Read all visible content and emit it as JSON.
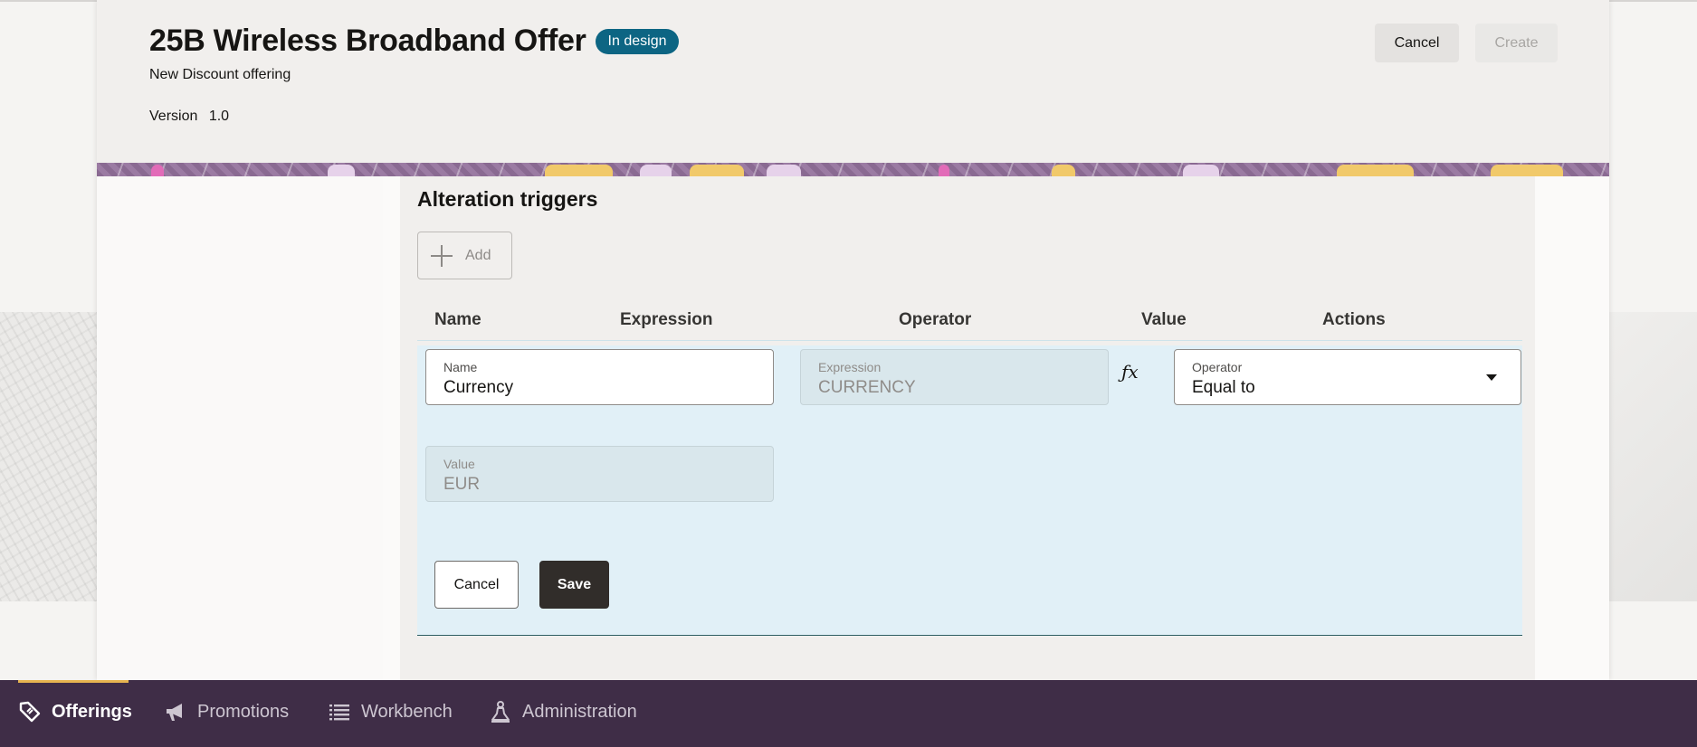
{
  "header": {
    "title": "25B Wireless Broadband Offer",
    "status": "In design",
    "subtitle": "New Discount offering",
    "version_label": "Version",
    "version_value": "1.0",
    "cancel_label": "Cancel",
    "create_label": "Create"
  },
  "section": {
    "title": "Alteration triggers",
    "add_label": "Add"
  },
  "table": {
    "columns": [
      "Name",
      "Expression",
      "Operator",
      "Value",
      "Actions"
    ]
  },
  "edit_row": {
    "name": {
      "label": "Name",
      "value": "Currency"
    },
    "expression": {
      "label": "Expression",
      "value": "CURRENCY"
    },
    "operator": {
      "label": "Operator",
      "value": "Equal to"
    },
    "value": {
      "label": "Value",
      "value": "EUR"
    },
    "fx": "ƒx",
    "cancel_label": "Cancel",
    "save_label": "Save"
  },
  "nav": {
    "items": [
      {
        "label": "Offerings",
        "icon": "tag-icon",
        "active": true
      },
      {
        "label": "Promotions",
        "icon": "megaphone-icon",
        "active": false
      },
      {
        "label": "Workbench",
        "icon": "list-icon",
        "active": false
      },
      {
        "label": "Administration",
        "icon": "admin-flask-icon",
        "active": false
      }
    ]
  },
  "colors": {
    "badge": "#0d6583",
    "nav_bg": "#3f2d47",
    "nav_indicator": "#e7b450",
    "edit_row_bg": "#e1f0f7",
    "save_button": "#312d2a"
  }
}
